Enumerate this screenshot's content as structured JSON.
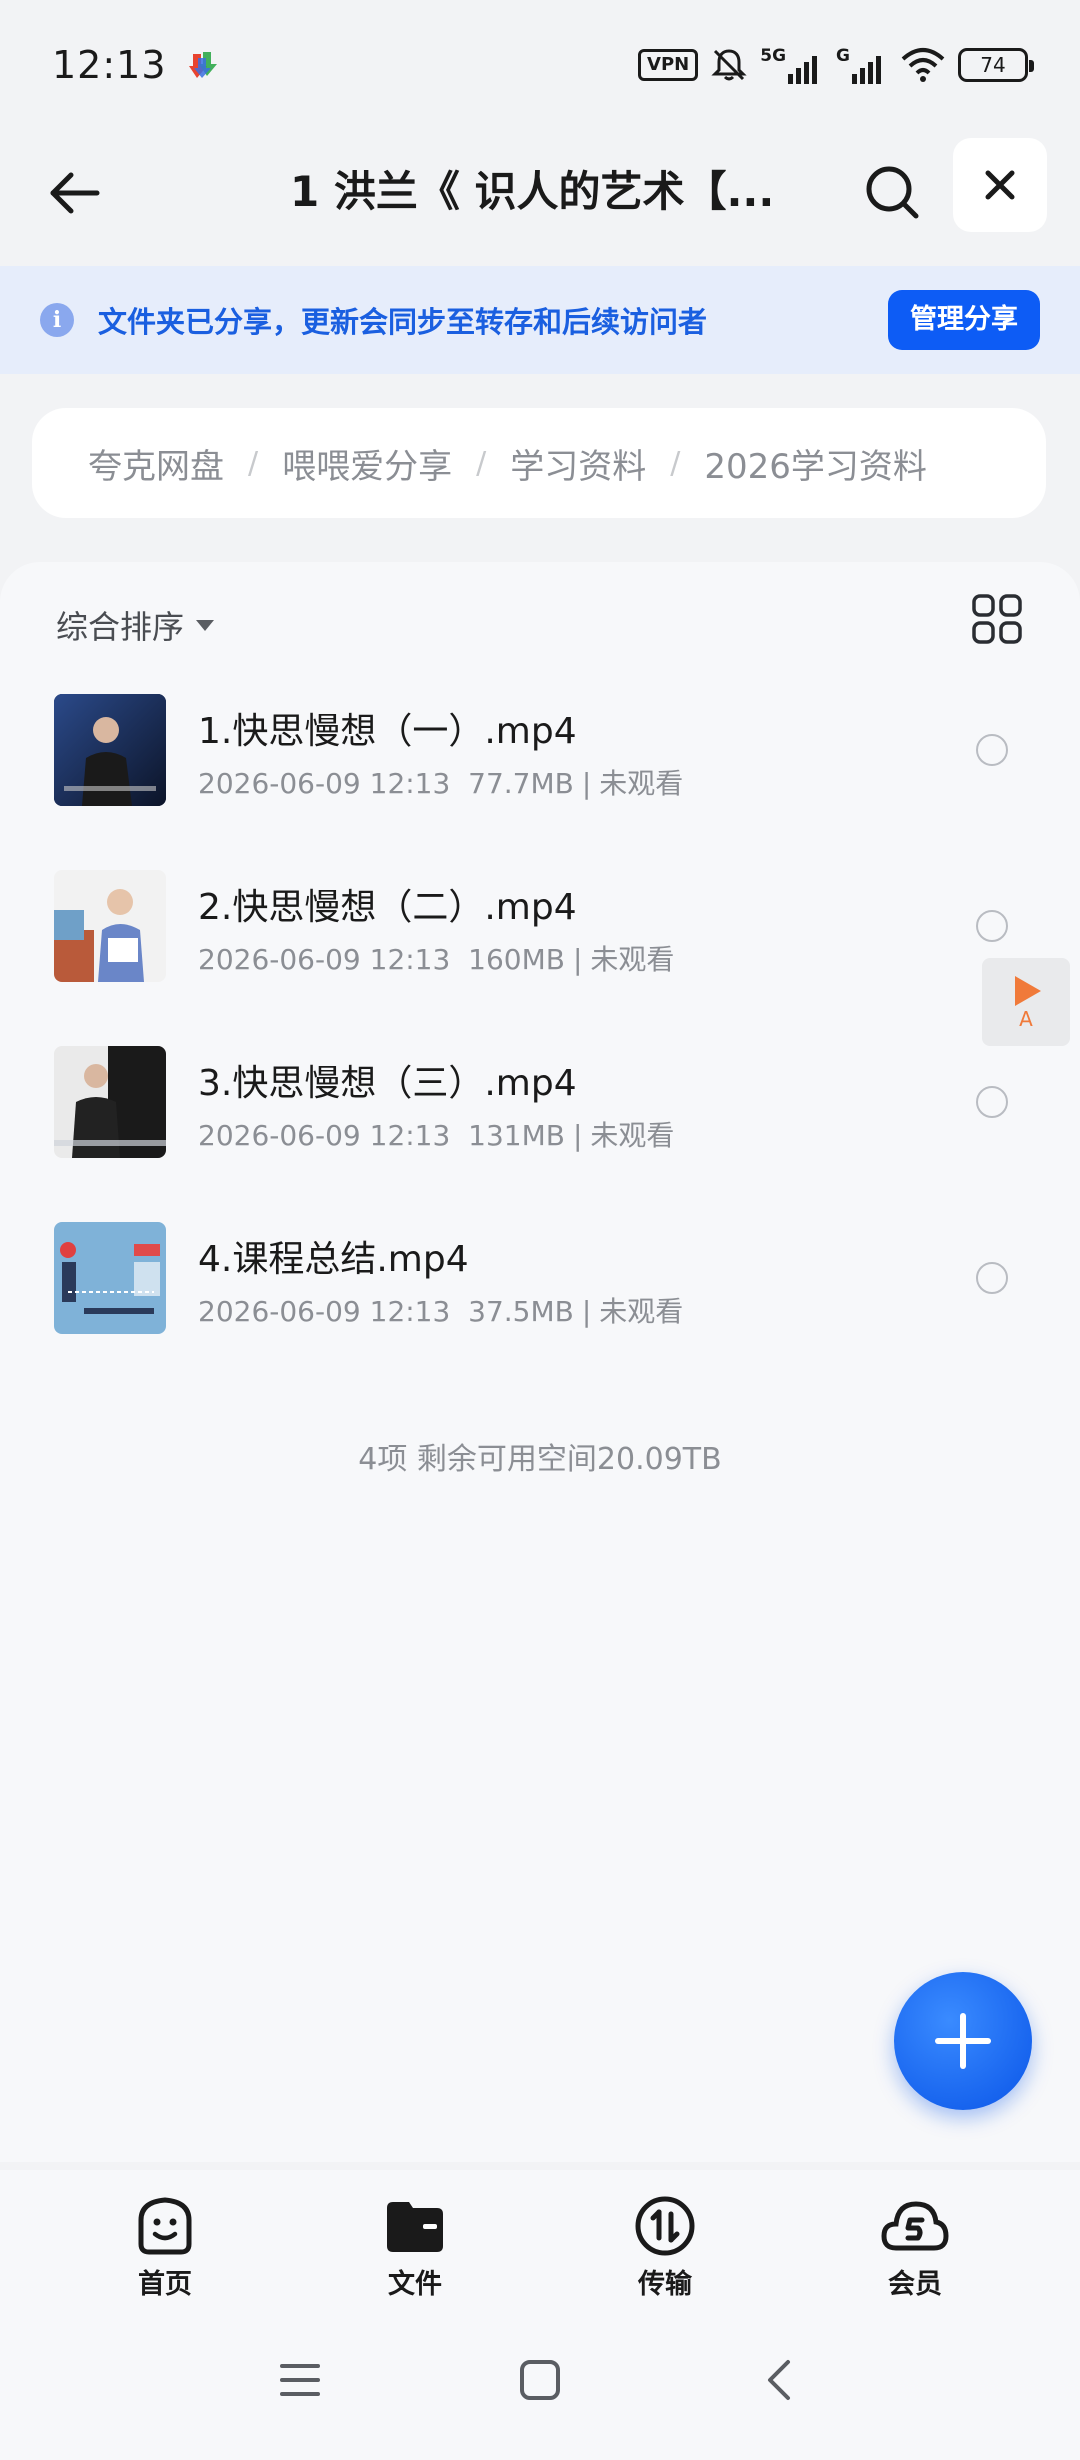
{
  "status_bar": {
    "time": "12:13",
    "vpn": "VPN",
    "network_5g": "5G",
    "network_g": "G",
    "battery": "74"
  },
  "header": {
    "title": "1 洪兰《 识人的艺术【...",
    "back_icon": "arrow-left-icon",
    "search_icon": "search-icon",
    "close_icon": "close-icon"
  },
  "share_banner": {
    "text": "文件夹已分享，更新会同步至转存和后续访问者",
    "button": "管理分享"
  },
  "breadcrumb": {
    "items": [
      "夸克网盘",
      "喂喂爱分享",
      "学习资料",
      "2026学习资料"
    ],
    "separator": "/"
  },
  "toolbar": {
    "sort_label": "综合排序"
  },
  "files": [
    {
      "name": "1.快思慢想（一）.mp4",
      "date": "2026-06-09 12:13",
      "size": "77.7MB",
      "status": "未观看"
    },
    {
      "name": "2.快思慢想（二）.mp4",
      "date": "2026-06-09 12:13",
      "size": "160MB",
      "status": "未观看"
    },
    {
      "name": "3.快思慢想（三）.mp4",
      "date": "2026-06-09 12:13",
      "size": "131MB",
      "status": "未观看"
    },
    {
      "name": "4.课程总结.mp4",
      "date": "2026-06-09 12:13",
      "size": "37.5MB",
      "status": "未观看"
    }
  ],
  "meta_separator": "|",
  "footer_info": "4项 剩余可用空间20.09TB",
  "float_player": {
    "label": "A"
  },
  "tabs": [
    {
      "label": "首页",
      "icon": "smiley-home-icon"
    },
    {
      "label": "文件",
      "icon": "folder-icon"
    },
    {
      "label": "传输",
      "icon": "transfer-icon"
    },
    {
      "label": "会员",
      "icon": "cloud-vip-icon"
    }
  ],
  "colors": {
    "accent": "#0d5cf5",
    "banner_bg": "#e6edfb",
    "banner_text": "#1a5fe0",
    "muted_text": "#8b8e94"
  }
}
